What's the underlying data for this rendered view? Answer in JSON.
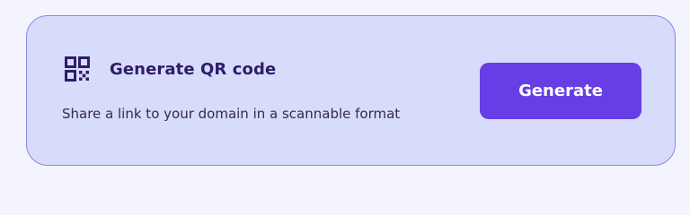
{
  "card": {
    "icon": "qr-code-icon",
    "title": "Generate QR code",
    "description": "Share a link to your domain in a scannable format",
    "button_label": "Generate"
  },
  "colors": {
    "background": "#f4f4ff",
    "card_background": "#d7dcfb",
    "card_border": "#8c84ea",
    "accent": "#673de6",
    "title_text": "#2f1c6a",
    "body_text": "#35294f"
  }
}
